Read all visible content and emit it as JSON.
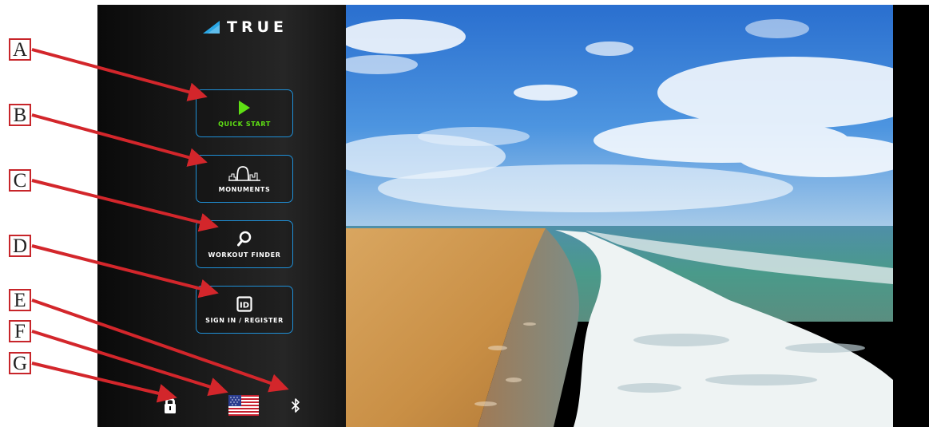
{
  "brand": {
    "name": "TRUE",
    "accent": "#2aa7e6"
  },
  "menu": {
    "quick_start": {
      "label": "QUICK START",
      "icon": "play-icon",
      "color": "#5fe014"
    },
    "monuments": {
      "label": "MONUMENTS",
      "icon": "arch-monument-icon"
    },
    "workout_finder": {
      "label": "WORKOUT FINDER",
      "icon": "search-icon"
    },
    "sign_in": {
      "label": "SIGN IN / REGISTER",
      "icon": "id-card-icon"
    }
  },
  "status_icons": {
    "lock": "lock-icon",
    "language": "us-flag-icon",
    "bluetooth": "bluetooth-icon"
  },
  "callouts": [
    "A",
    "B",
    "C",
    "D",
    "E",
    "F",
    "G"
  ],
  "colors": {
    "button_border": "#1f8fd6",
    "callout_red": "#c7252a"
  }
}
